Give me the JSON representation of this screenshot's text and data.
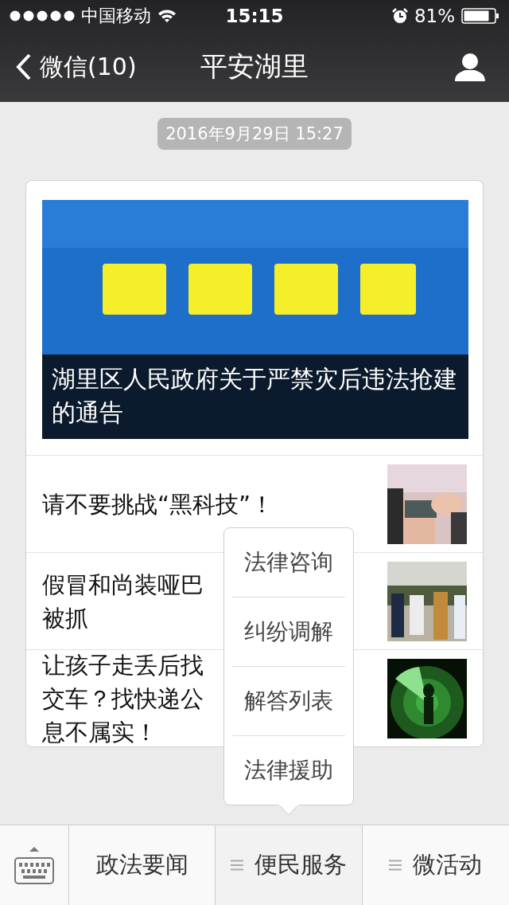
{
  "status_bar": {
    "carrier": "中国移动",
    "time": "15:15",
    "battery": "81%"
  },
  "nav": {
    "back": "微信(10)",
    "title": "平安湖里"
  },
  "timestamp": "2016年9月29日 15:27",
  "feature": {
    "kind": "picture",
    "caption": "湖里区人民政府关于严禁灾后违法抢建的通告"
  },
  "articles": [
    {
      "lines": [
        "请不要挑战“黑科技”！"
      ]
    },
    {
      "lines": [
        "假冒和尚装哑巴",
        "被抓"
      ]
    },
    {
      "lines": [
        "让孩子走丢后找",
        "交车？找快递公",
        "息不属实！"
      ]
    }
  ],
  "bottom_menu": [
    {
      "label": "政法要闻",
      "kind": "link",
      "expanded": false
    },
    {
      "label": "便民服务",
      "kind": "submenu",
      "expanded": true,
      "submenu": [
        "法律咨询",
        "纠纷调解",
        "解答列表",
        "法律援助"
      ]
    },
    {
      "label": "微活动",
      "kind": "submenu",
      "expanded": false
    }
  ]
}
